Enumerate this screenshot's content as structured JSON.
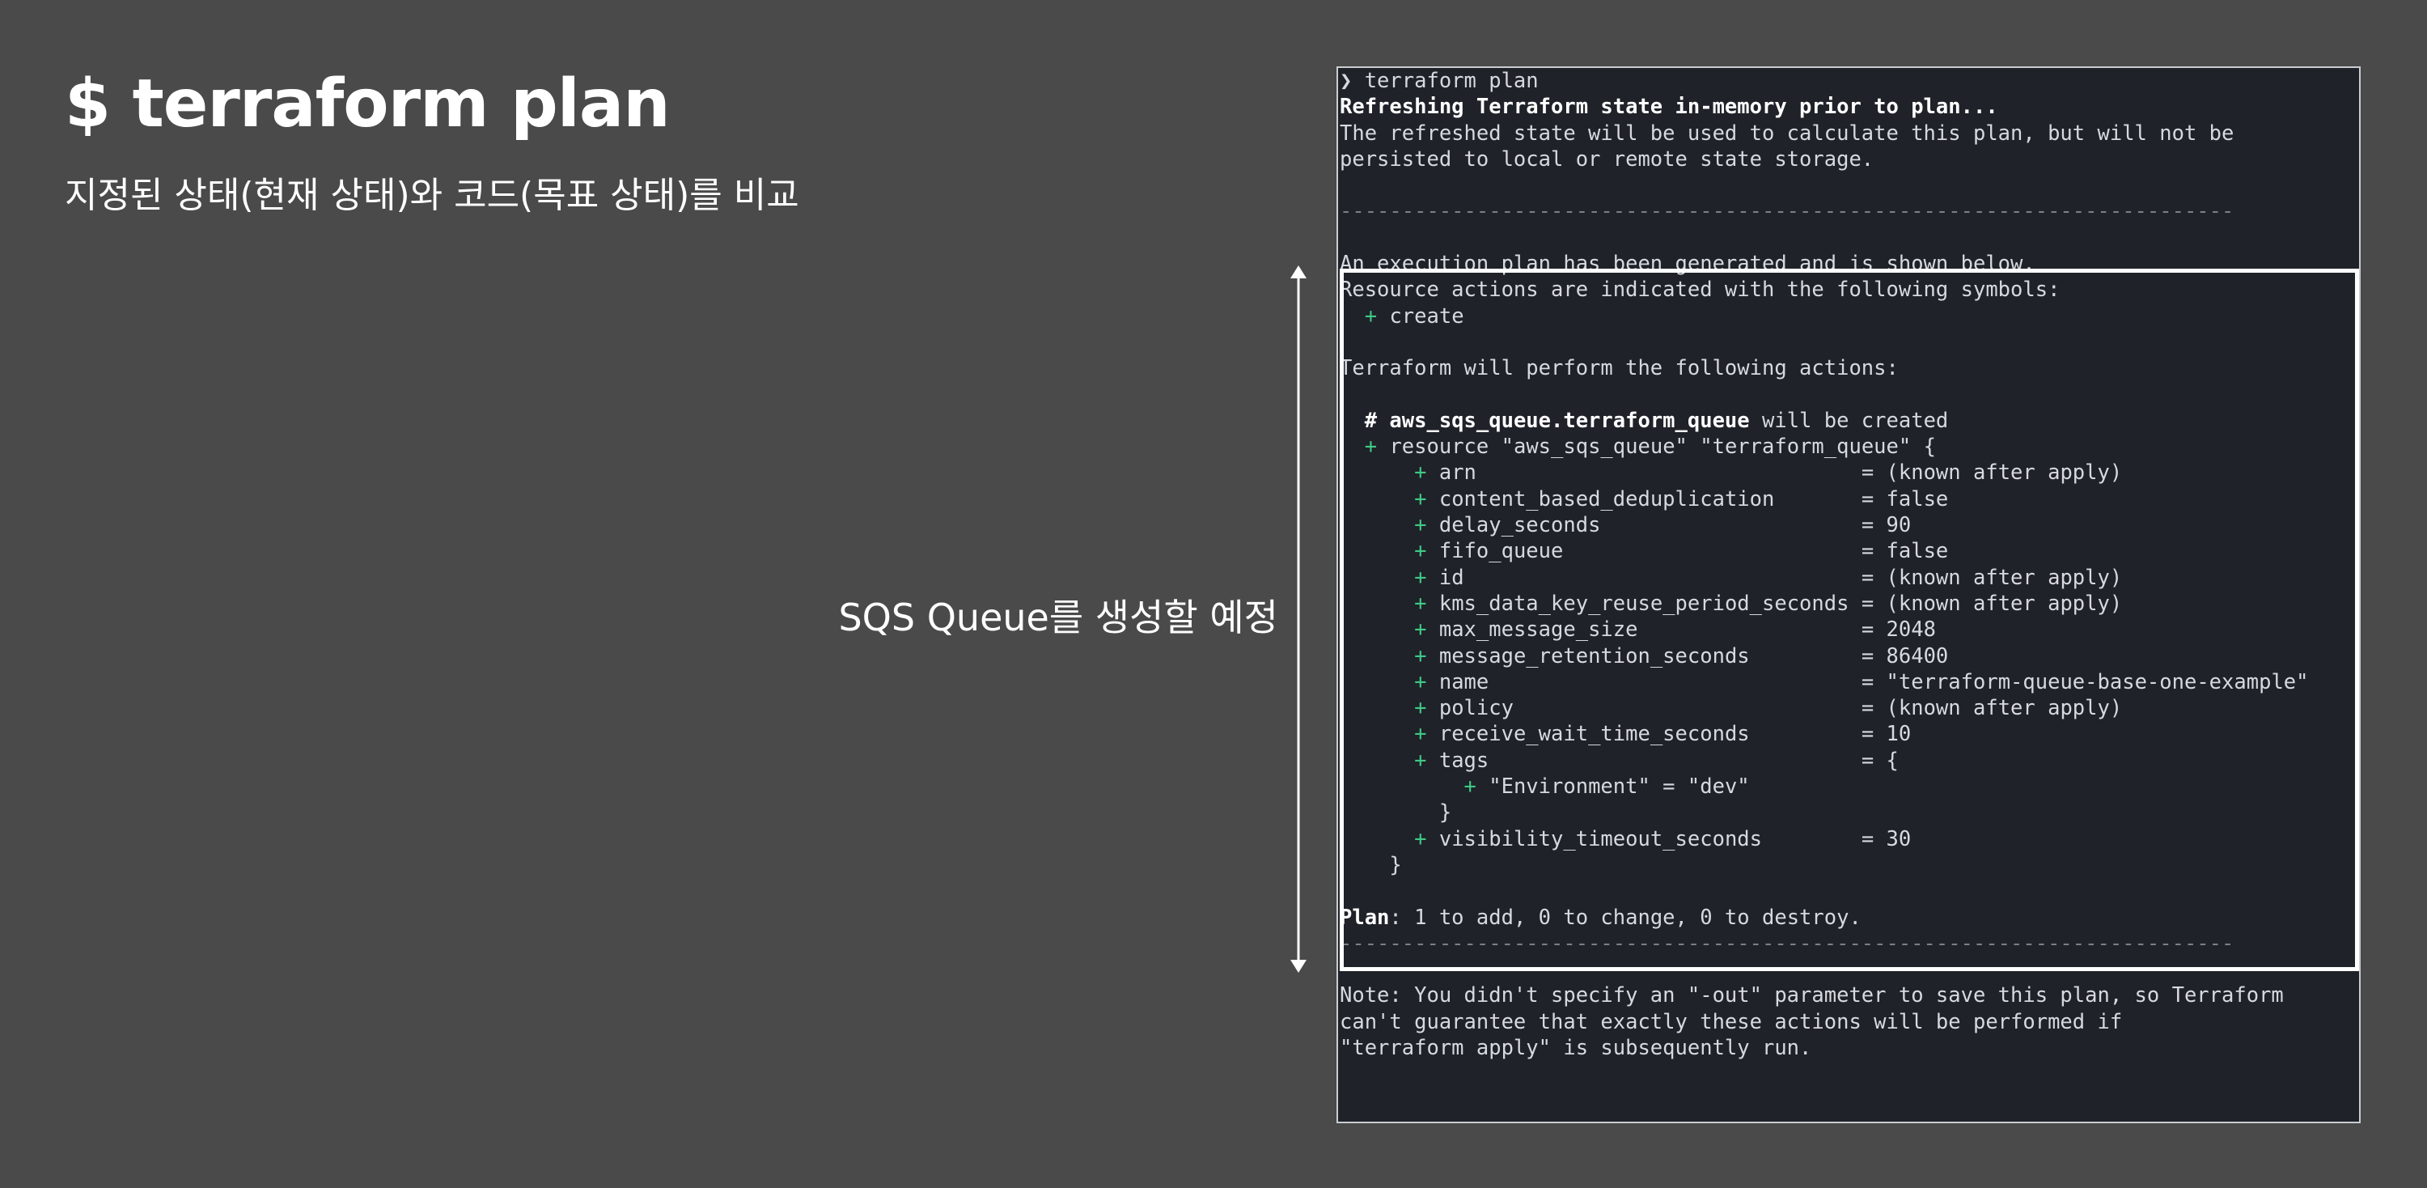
{
  "slide": {
    "title": "$ terraform plan",
    "subtitle": "지정된 상태(현재 상태)와 코드(목표 상태)를 비교",
    "annotation": "SQS Queue를 생성할 예정"
  },
  "terminal": {
    "prompt": "❯ terraform plan",
    "refreshing": "Refreshing Terraform state in-memory prior to plan...",
    "refresh_note_1": "The refreshed state will be used to calculate this plan, but will not be",
    "refresh_note_2": "persisted to local or remote state storage.",
    "separator": "------------------------------------------------------------------------",
    "exec_plan": "An execution plan has been generated and is shown below.",
    "symbols_intro": "Resource actions are indicated with the following symbols:",
    "symbol_create": "create",
    "perform": "Terraform will perform the following actions:",
    "resource_comment": "# aws_sqs_queue.terraform_queue",
    "resource_comment_suffix": " will be created",
    "resource_decl": "resource \"aws_sqs_queue\" \"terraform_queue\" {",
    "attributes": [
      "arn                               = (known after apply)",
      "content_based_deduplication       = false",
      "delay_seconds                     = 90",
      "fifo_queue                        = false",
      "id                                = (known after apply)",
      "kms_data_key_reuse_period_seconds = (known after apply)",
      "max_message_size                  = 2048",
      "message_retention_seconds         = 86400",
      "name                              = \"terraform-queue-base-one-example\"",
      "policy                            = (known after apply)",
      "receive_wait_time_seconds         = 10",
      "tags                              = {"
    ],
    "tag_entry": "\"Environment\" = \"dev\"",
    "tags_close": "}",
    "visibility": "visibility_timeout_seconds        = 30",
    "resource_close": "}",
    "plan_label": "Plan",
    "plan_summary": ": 1 to add, 0 to change, 0 to destroy.",
    "note_1": "Note: You didn't specify an \"-out\" parameter to save this plan, so Terraform",
    "note_2": "can't guarantee that exactly these actions will be performed if",
    "note_3": "\"terraform apply\" is subsequently run.",
    "plus_symbol": "+"
  }
}
